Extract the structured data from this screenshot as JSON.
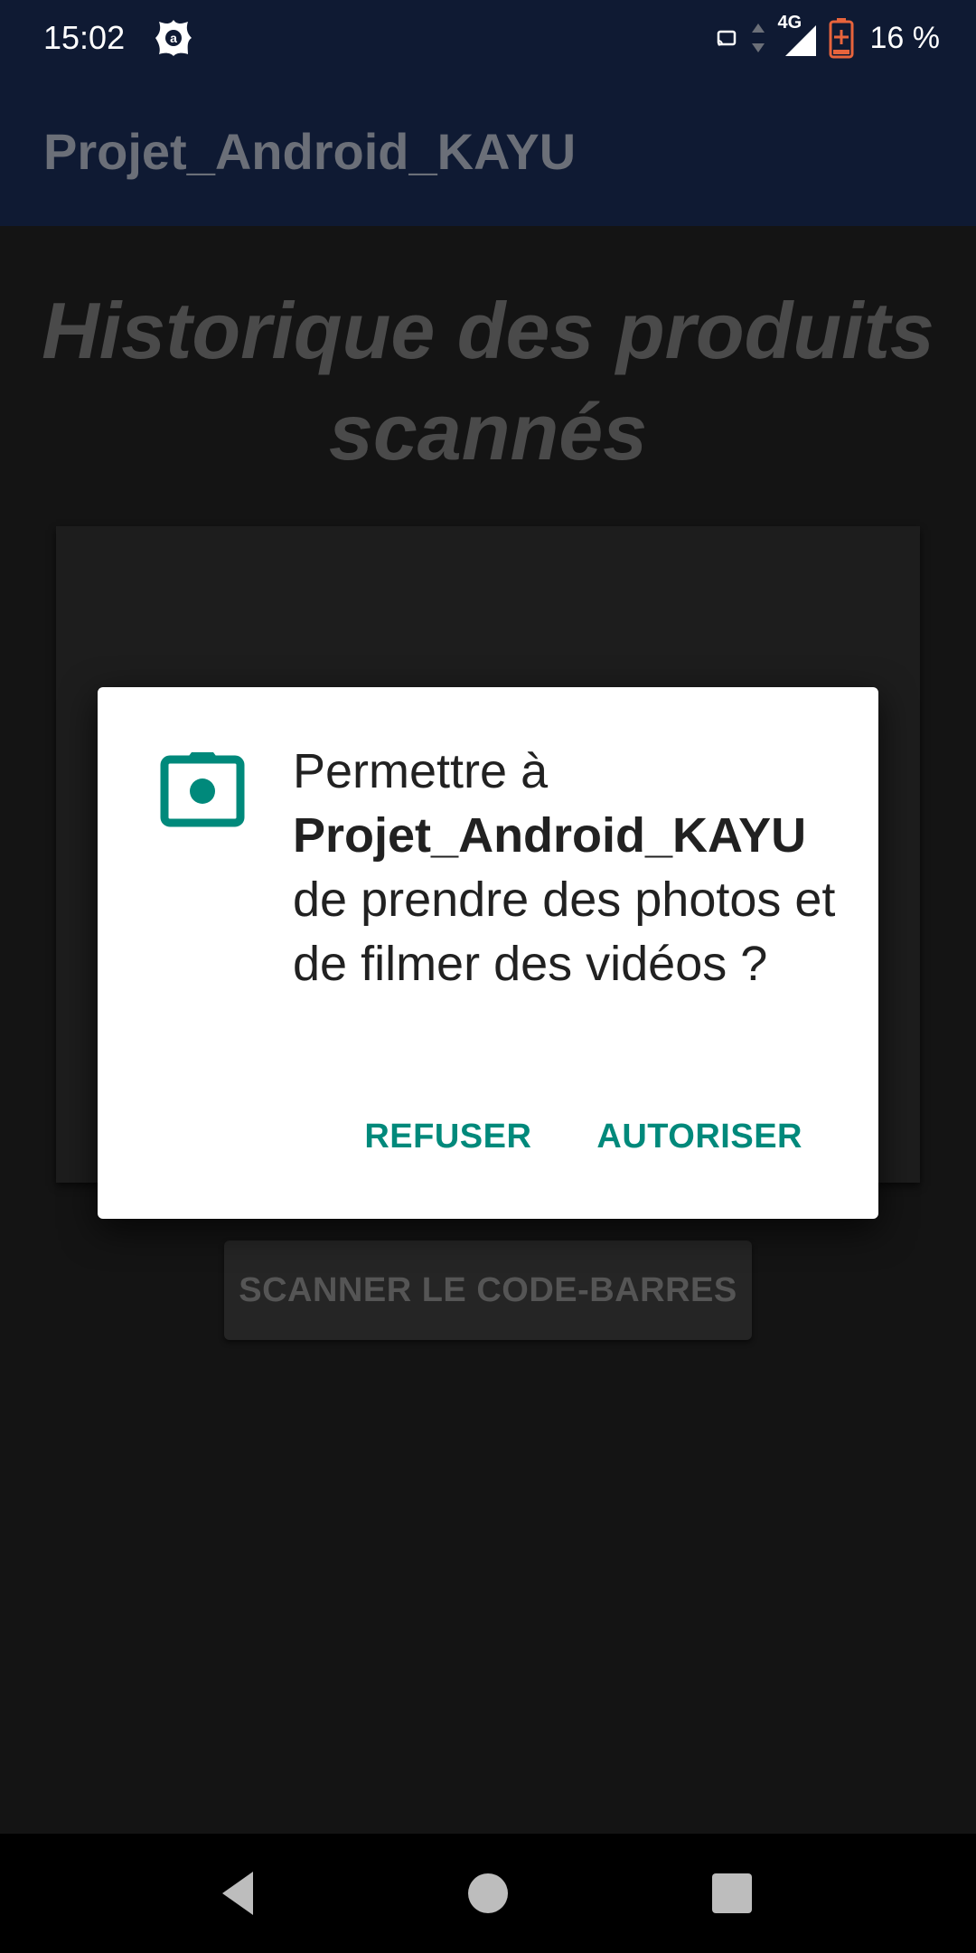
{
  "status_bar": {
    "time": "15:02",
    "network": "4G",
    "battery": "16 %",
    "icons": [
      "app-notification-icon",
      "cast-icon",
      "data-arrows-icon",
      "signal-icon",
      "battery-charging-icon"
    ],
    "battery_color": "#e8643c"
  },
  "app_bar": {
    "title": "Projet_Android_KAYU"
  },
  "main": {
    "heading": "Historique des produits scannés",
    "scan_button_label": "SCANNER LE CODE-BARRES"
  },
  "dialog": {
    "icon": "camera-icon",
    "message_prefix": "Permettre à",
    "app_name": "Projet_Android_KAYU",
    "message_suffix": "de prendre des photos et de filmer des vidéos ?",
    "deny_label": "REFUSER",
    "allow_label": "AUTORISER",
    "accent_color": "#00897b"
  },
  "nav_bar": {
    "buttons": [
      "back-icon",
      "home-icon",
      "recents-icon"
    ]
  }
}
